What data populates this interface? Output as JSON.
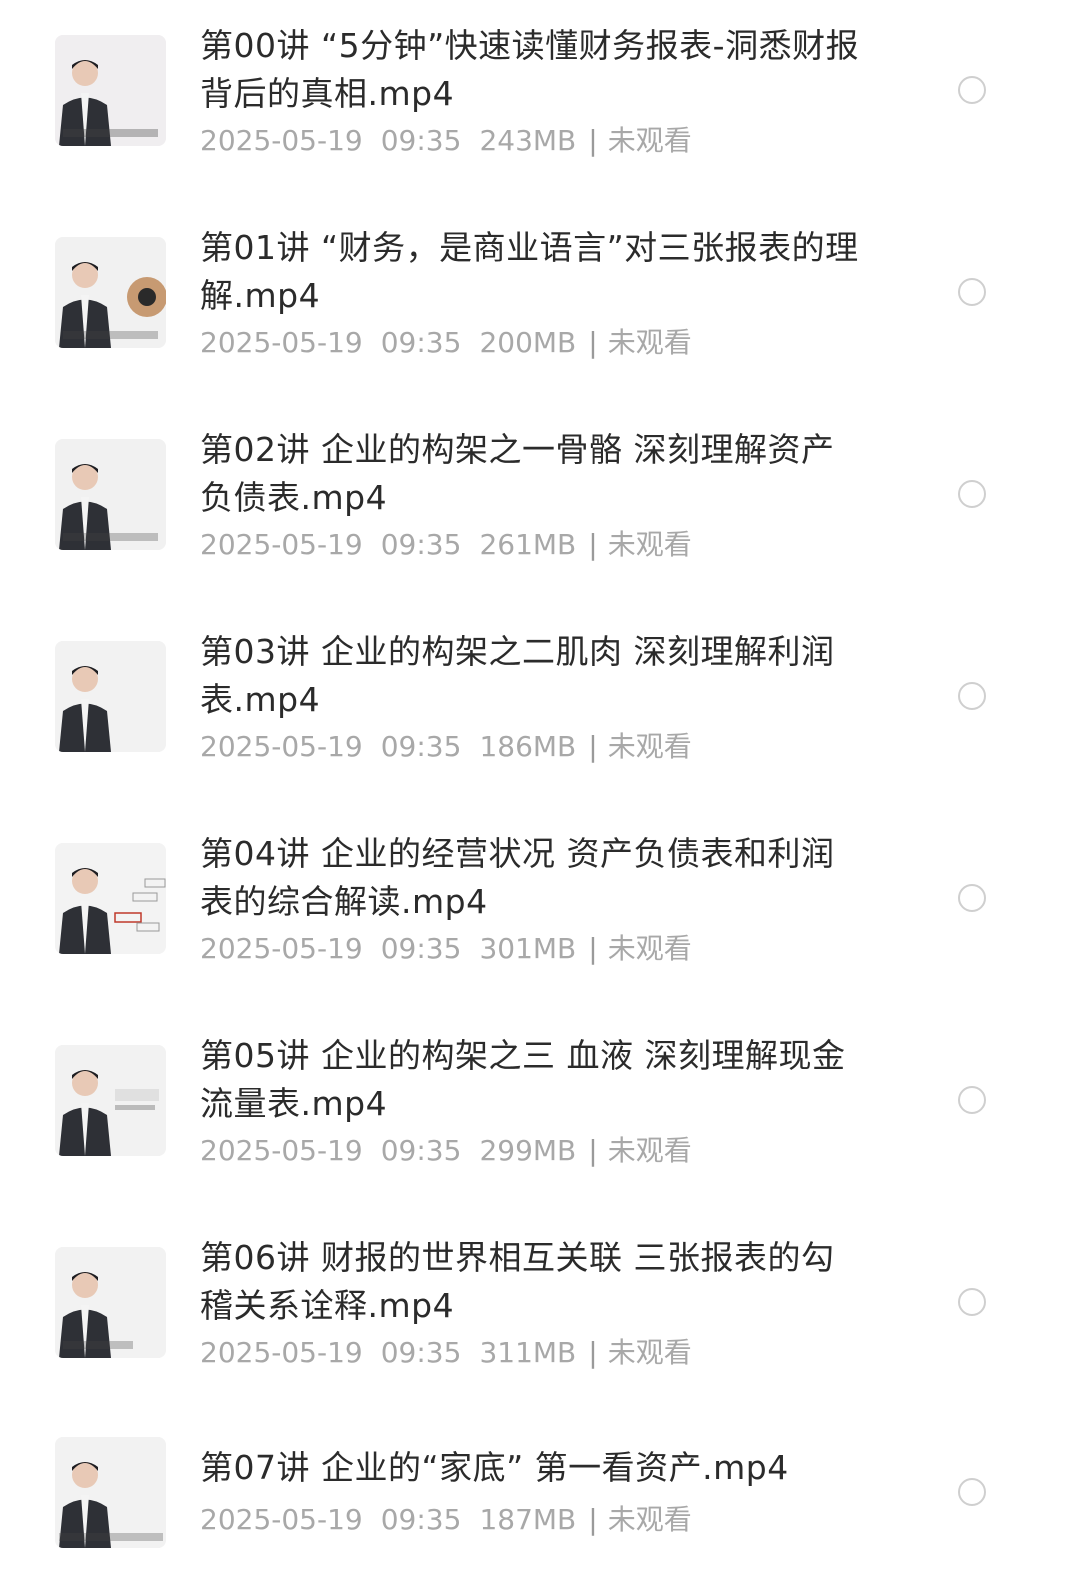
{
  "files": [
    {
      "title": "第00讲 “5分钟”快速读懂财务报表-洞悉财报背后的真相.mp4",
      "date": "2025-05-19",
      "time": "09:35",
      "size": "243MB",
      "status": "未观看"
    },
    {
      "title": "第01讲 “财务，是商业语言”对三张报表的理解.mp4",
      "date": "2025-05-19",
      "time": "09:35",
      "size": "200MB",
      "status": "未观看"
    },
    {
      "title": "第02讲 企业的构架之一骨骼 深刻理解资产负债表.mp4",
      "date": "2025-05-19",
      "time": "09:35",
      "size": "261MB",
      "status": "未观看"
    },
    {
      "title": "第03讲 企业的构架之二肌肉 深刻理解利润表.mp4",
      "date": "2025-05-19",
      "time": "09:35",
      "size": "186MB",
      "status": "未观看"
    },
    {
      "title": "第04讲 企业的经营状况 资产负债表和利润表的综合解读.mp4",
      "date": "2025-05-19",
      "time": "09:35",
      "size": "301MB",
      "status": "未观看"
    },
    {
      "title": "第05讲 企业的构架之三 血液 深刻理解现金流量表.mp4",
      "date": "2025-05-19",
      "time": "09:35",
      "size": "299MB",
      "status": "未观看"
    },
    {
      "title": "第06讲 财报的世界相互关联 三张报表的勾稽关系诠释.mp4",
      "date": "2025-05-19",
      "time": "09:35",
      "size": "311MB",
      "status": "未观看"
    },
    {
      "title": "第07讲 企业的“家底” 第一看资产.mp4",
      "date": "2025-05-19",
      "time": "09:35",
      "size": "187MB",
      "status": "未观看"
    }
  ],
  "colors": {
    "title": "#2b2b2b",
    "meta": "#a8a8a8",
    "radio_border": "#cfcfcf",
    "thumb_bg": "#f2f2f2",
    "suit": "#2e3036"
  },
  "icons": {
    "selector": "radio-circle-icon",
    "thumbnail": "video-thumbnail"
  }
}
